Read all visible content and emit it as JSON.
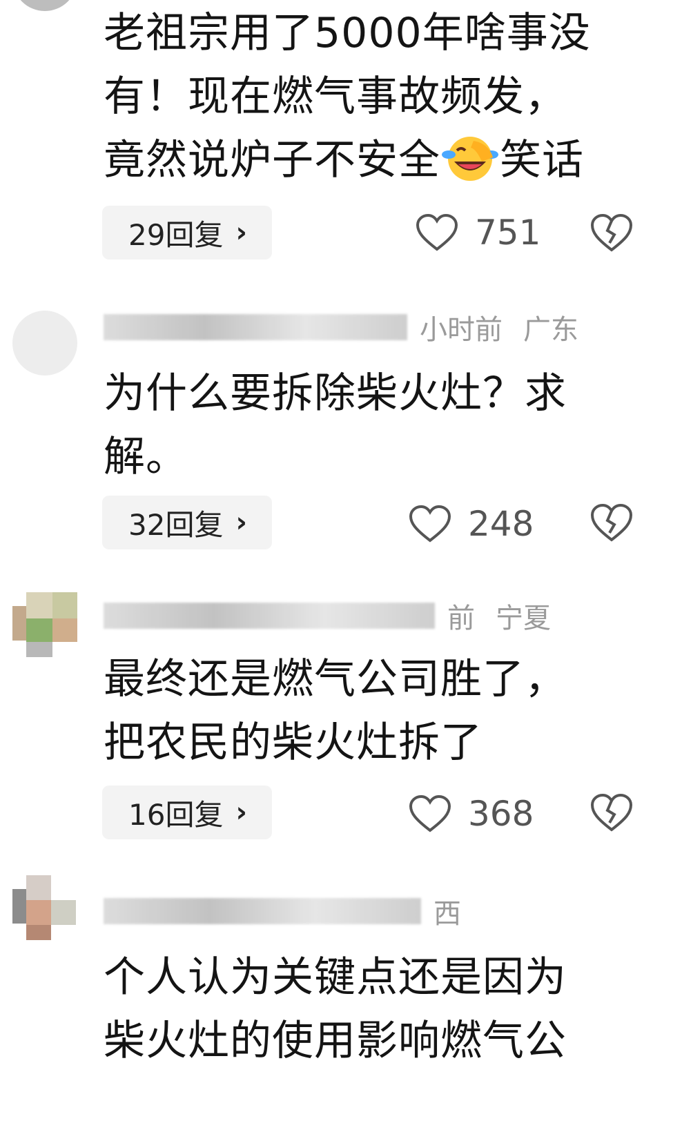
{
  "comments": [
    {
      "user": "",
      "time": "",
      "location": "",
      "lines": [
        "老祖宗用了5000年啥事没",
        "有！现在燃气事故频发，",
        "竟然说炉子不安全",
        "笑话"
      ],
      "emoji": "laughing-crying-emoji",
      "replies": "29回复",
      "likes": "751"
    },
    {
      "user": "",
      "time": "小时前",
      "location": "广东",
      "lines": [
        "为什么要拆除柴火灶？求",
        "解。"
      ],
      "replies": "32回复",
      "likes": "248"
    },
    {
      "user": "",
      "time": "前",
      "location": "宁夏",
      "lines": [
        "最终还是燃气公司胜了，",
        "把农民的柴火灶拆了"
      ],
      "replies": "16回复",
      "likes": "368"
    },
    {
      "user": "",
      "time": "",
      "location": "西",
      "lines": [
        "个人认为关键点还是因为",
        "柴火灶的使用影响燃气公"
      ],
      "replies": "",
      "likes": ""
    }
  ],
  "icons": {
    "like": "heart-outline-icon",
    "dislike": "broken-heart-icon",
    "chevron": "chevron-right-icon"
  },
  "colors": {
    "text": "#141414",
    "muted": "#8e8e8e",
    "pill": "#f3f3f3"
  }
}
